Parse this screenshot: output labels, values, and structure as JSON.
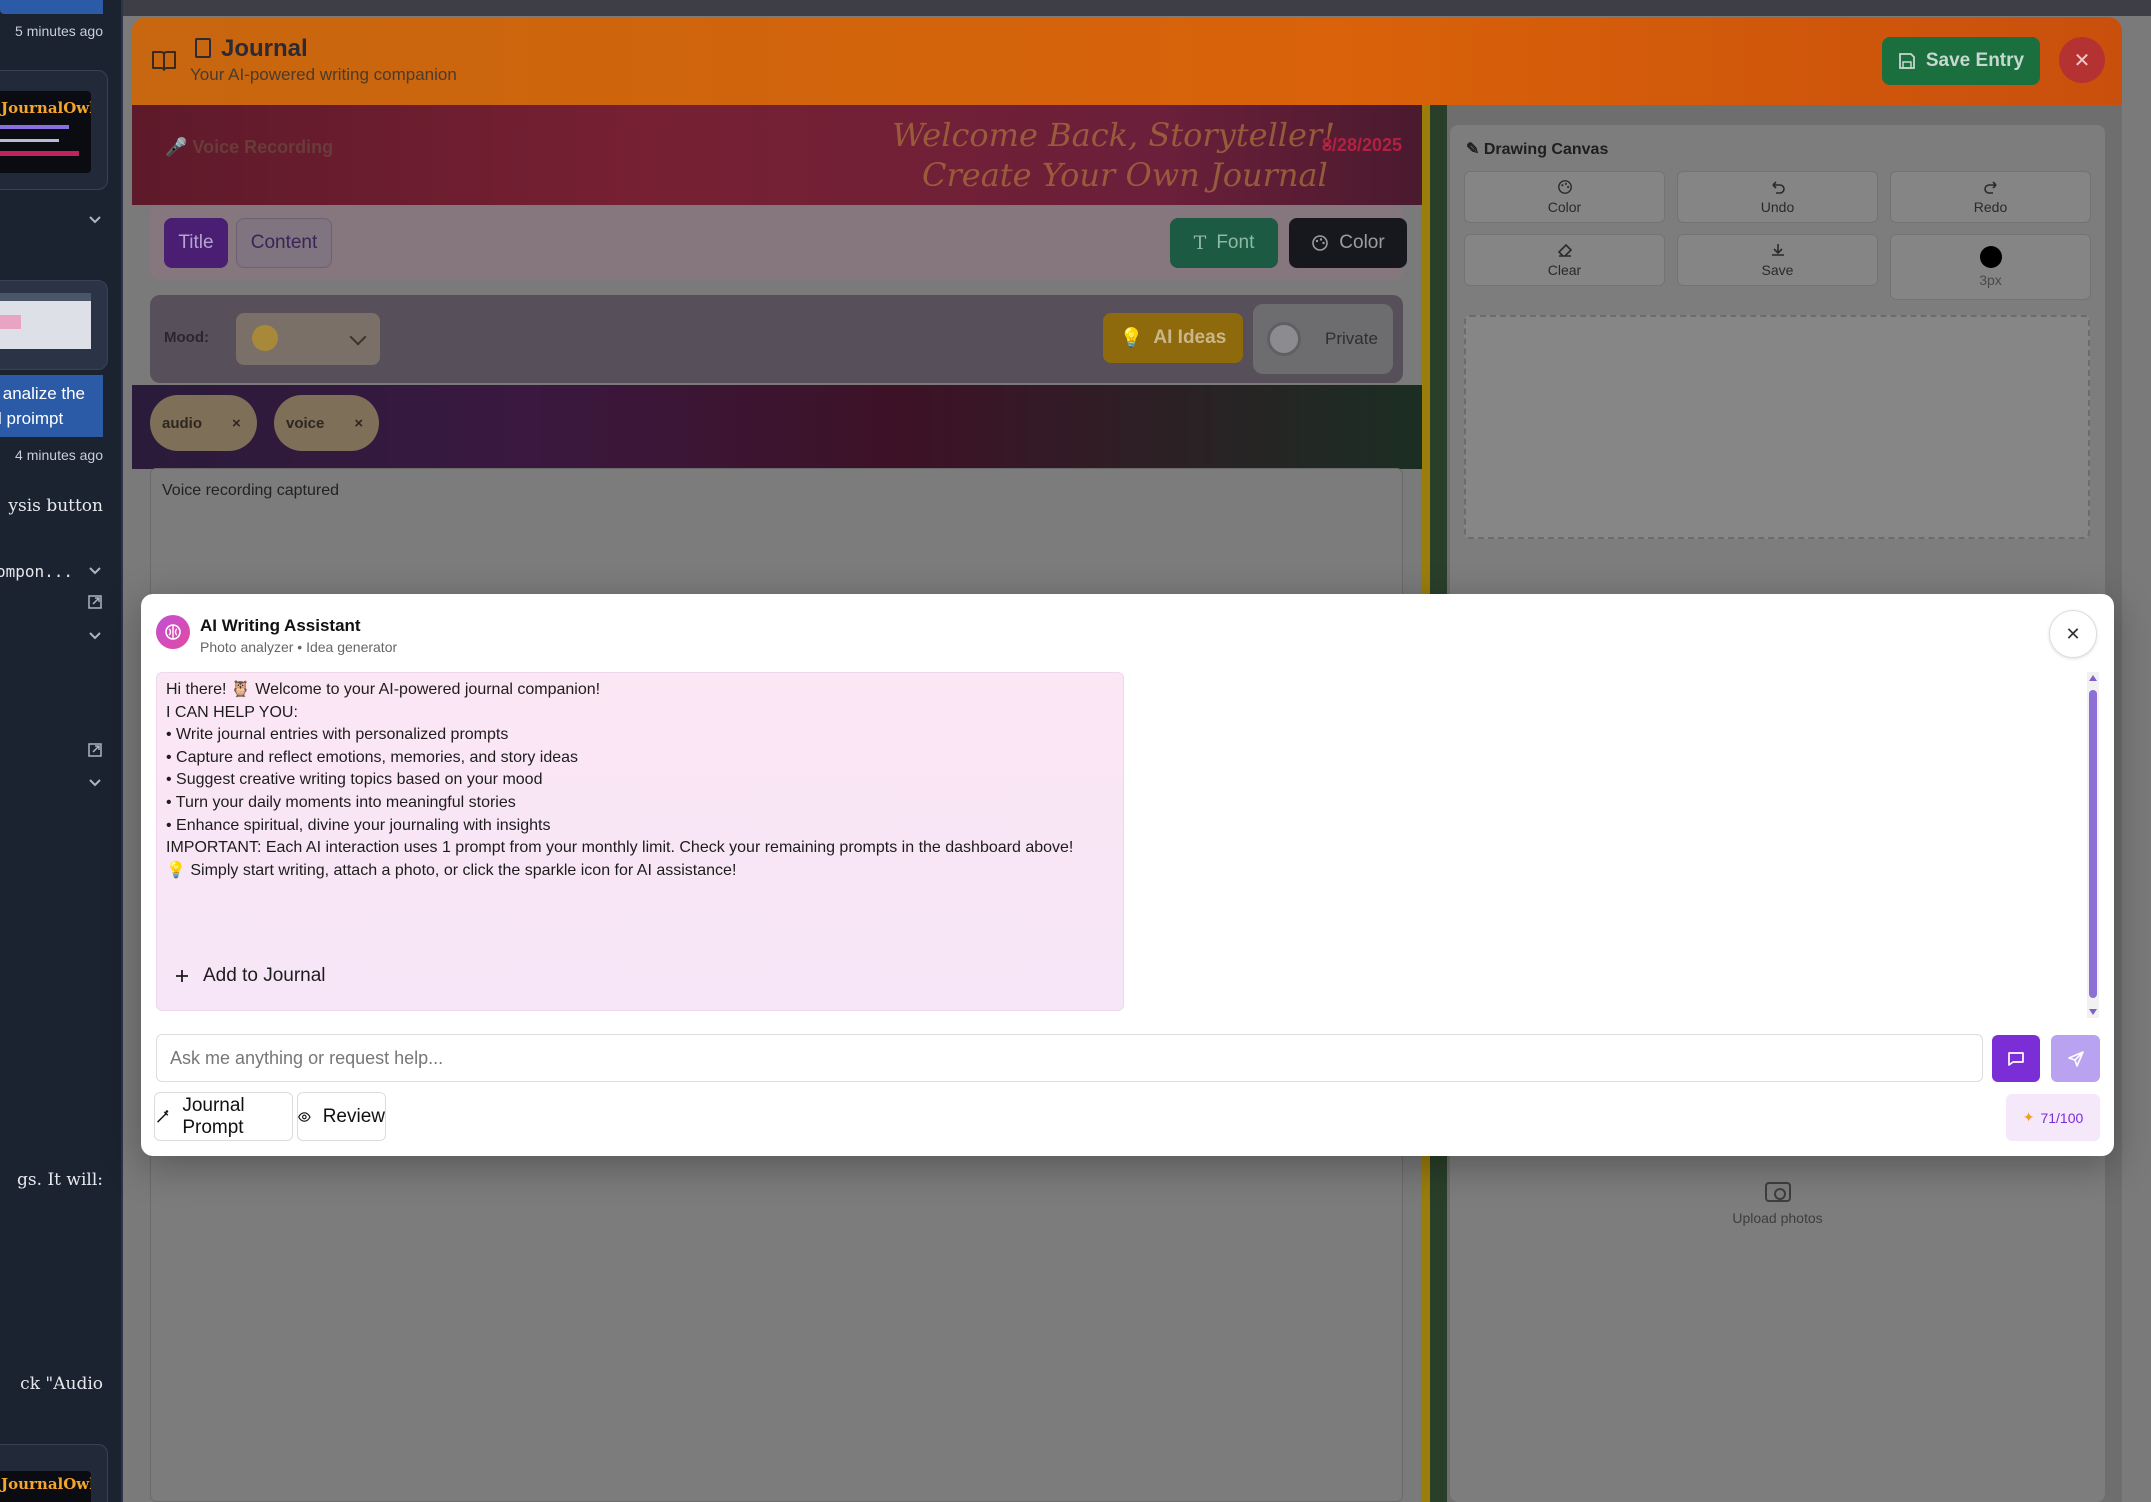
{
  "left_panel": {
    "msg_top_time": "5 minutes ago",
    "thumb_logo": "JournalOwl",
    "user_msg_line1": "n analize the",
    "user_msg_line2": "al proimpt",
    "user_msg_time": "4 minutes ago",
    "text_analysis_button": "ysis button",
    "code_ref": "/compon...",
    "text_will": "gs. It will:",
    "text_audio": "ck \"Audio"
  },
  "journal": {
    "title": "Journal",
    "subtitle": "Your AI-powered writing companion",
    "save_label": "Save Entry",
    "banner_text_line1": "Welcome Back, Storyteller!",
    "banner_text_line2": "Create Your Own Journal",
    "banner_date": "8/28/2025",
    "voice_label": "Voice Recording",
    "toolbar": {
      "title_tab": "Title",
      "content_tab": "Content",
      "font_label": "Font",
      "color_label": "Color"
    },
    "mood_label": "Mood:",
    "ai_ideas_label": "AI Ideas",
    "private_label": "Private",
    "tags": [
      "audio",
      "voice"
    ],
    "tag_remove": "×",
    "content_text": "Voice recording captured"
  },
  "drawing_canvas": {
    "title": "Drawing Canvas",
    "buttons": [
      {
        "label": "Color",
        "icon": "palette-icon"
      },
      {
        "label": "Undo",
        "icon": "undo-icon"
      },
      {
        "label": "Redo",
        "icon": "redo-icon"
      },
      {
        "label": "Clear",
        "icon": "eraser-icon"
      },
      {
        "label": "Save",
        "icon": "download-icon"
      }
    ],
    "brush_size": "3px",
    "upload_label": "Upload photos"
  },
  "assistant": {
    "name": "AI Writing Assistant",
    "subtitle": "Photo analyzer • Idea generator",
    "message_lines": [
      "Hi there! 🦉 Welcome to your AI-powered journal companion!",
      "",
      "I CAN HELP YOU:",
      "• Write journal entries with personalized prompts",
      "• Capture and reflect emotions, memories, and story ideas",
      "• Suggest creative writing topics based on your mood",
      "• Turn your daily moments into meaningful stories",
      "• Enhance spiritual, divine your journaling with insights",
      "",
      "IMPORTANT: Each AI interaction uses 1 prompt from your monthly limit. Check your remaining prompts in the dashboard above!",
      "",
      "💡 Simply start writing, attach a photo, or click the sparkle icon for AI assistance!"
    ],
    "add_to_journal": "Add to Journal",
    "input_placeholder": "Ask me anything or request help...",
    "journal_prompt_label": "Journal Prompt",
    "review_label": "Review",
    "prompt_count": "71/100"
  },
  "colors": {
    "header_orange": "#d9620a",
    "save_green": "#1b6e3e",
    "accent_purple": "#7b2dd6",
    "bubble_pink": "#fbe6f4"
  }
}
